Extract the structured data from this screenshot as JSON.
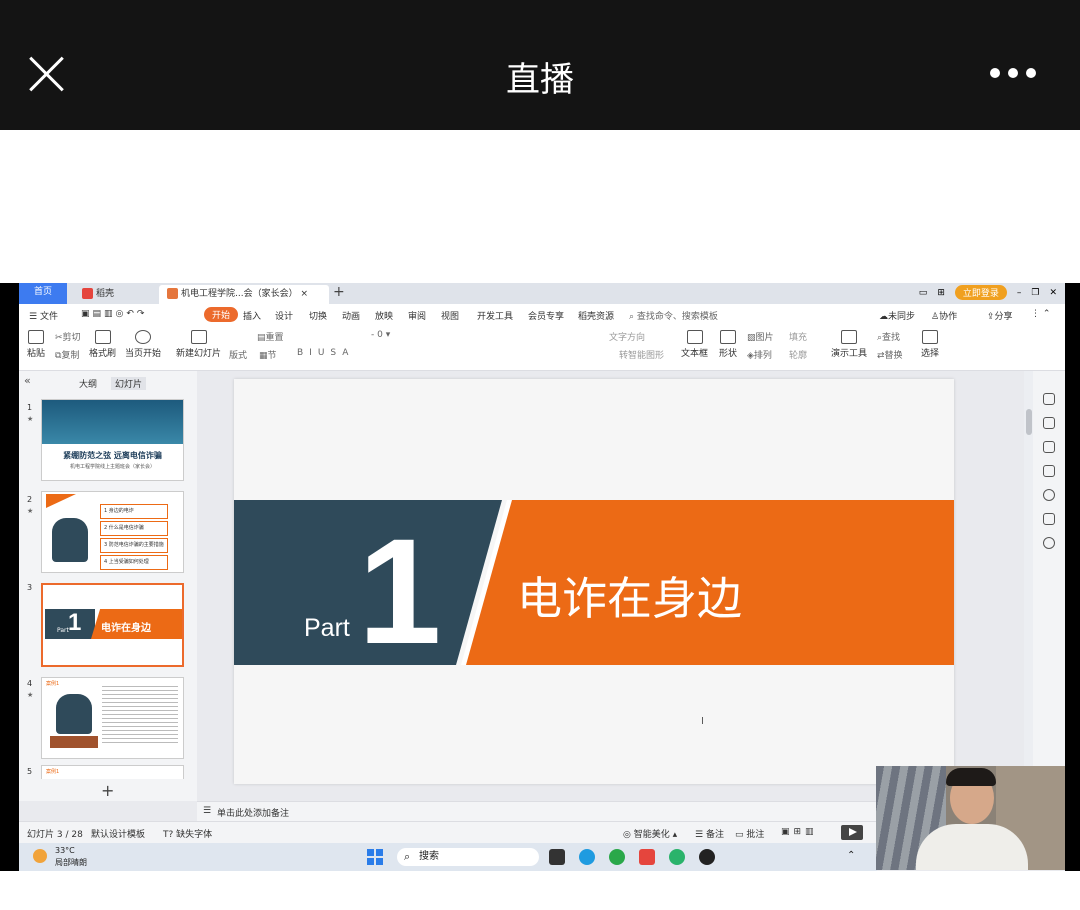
{
  "app": {
    "title": "直播"
  },
  "wps": {
    "tabs": {
      "home": "首页",
      "wps": "稻壳",
      "doc": "机电工程学院...会（家长会）",
      "add": "+"
    },
    "login": "立即登录",
    "menu": [
      "文件",
      "开始",
      "插入",
      "设计",
      "切换",
      "动画",
      "放映",
      "审阅",
      "视图",
      "开发工具",
      "会员专享",
      "稻壳资源"
    ],
    "search_placeholder": "查找命令、搜索模板",
    "sync": "未同步",
    "collab": "协作",
    "share": "分享",
    "ribbon": {
      "paste": "粘贴",
      "cut": "剪切",
      "copy": "复制",
      "format_painter": "格式刷",
      "from_current": "当页开始",
      "new_slide": "新建幻灯片",
      "layout": "版式",
      "section": "节",
      "reset": "重置",
      "font_size": "0",
      "textbox": "文本框",
      "shape": "形状",
      "picture": "图片",
      "arrange": "排列",
      "presenter": "演示工具",
      "find": "查找",
      "replace": "替换",
      "select": "选择",
      "fill": "填充",
      "outline": "轮廓",
      "convert_smart": "转智能图形",
      "text_dir": "文字方向"
    },
    "panel_tabs": {
      "outline": "大纲",
      "slides": "幻灯片"
    },
    "thumbs": [
      {
        "num": "1",
        "title": "紧绷防范之弦  远离电信诈骗",
        "sub": "机电工程学院线上主题班会（家长会）"
      },
      {
        "num": "2",
        "items": [
          "1 身边的电诈",
          "2 什么是电信诈骗",
          "3 防范电信诈骗的主要措施",
          "4 上当受骗如何处理"
        ]
      },
      {
        "num": "3",
        "part": "Part",
        "big": "1",
        "label": "电诈在身边"
      },
      {
        "num": "4",
        "tag": "案例1"
      },
      {
        "num": "5",
        "tag": "案例1"
      }
    ],
    "slide": {
      "part": "Part",
      "number": "1",
      "headline": "电诈在身边"
    },
    "colors": {
      "navy": "#2f4a5a",
      "orange": "#ec6a15",
      "accent": "#3d7bf0"
    },
    "notes_placeholder": "单击此处添加备注",
    "status": {
      "slide_count": "幻灯片 3 / 28",
      "template": "默认设计模板",
      "missing_font": "缺失字体",
      "beautify": "智能美化",
      "notes": "备注",
      "comments": "批注"
    },
    "taskbar": {
      "temp": "33°C",
      "weather": "局部晴朗",
      "search": "搜索"
    }
  }
}
